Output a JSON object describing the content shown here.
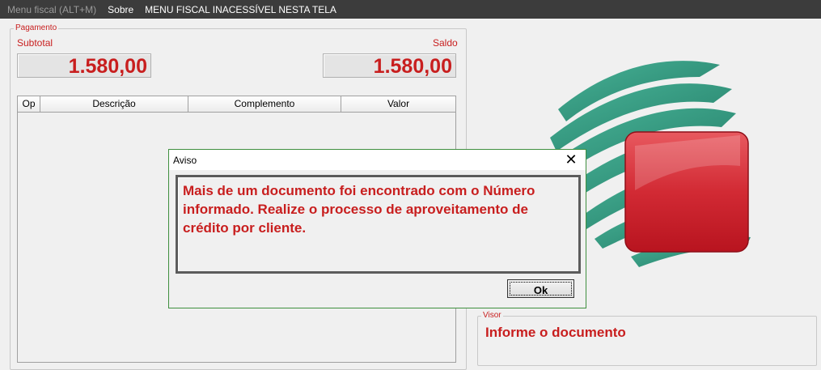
{
  "menu": {
    "fiscal_label": "Menu fiscal (ALT+M)",
    "sobre_label": "Sobre",
    "notice_label": "MENU FISCAL INACESSÍVEL NESTA TELA"
  },
  "pagamento": {
    "legend": "Pagamento",
    "subtotal_label": "Subtotal",
    "subtotal_value": "1.580,00",
    "saldo_label": "Saldo",
    "saldo_value": "1.580,00",
    "table": {
      "columns": [
        "Op",
        "Descrição",
        "Complemento",
        "Valor"
      ],
      "rows": []
    }
  },
  "visor": {
    "legend": "Visor",
    "text": "Informe o documento"
  },
  "dialog": {
    "title": "Aviso",
    "close_glyph": "✕",
    "message": "Mais de um documento foi encontrado com o Número informado. Realize o processo de aproveitamento de crédito por cliente.",
    "ok_label": "Ok"
  },
  "colors": {
    "accent_red": "#c81e1e",
    "menubar_bg": "#3c3c3c",
    "logo_green": "#2f9a80",
    "logo_red": "#d42a33"
  }
}
